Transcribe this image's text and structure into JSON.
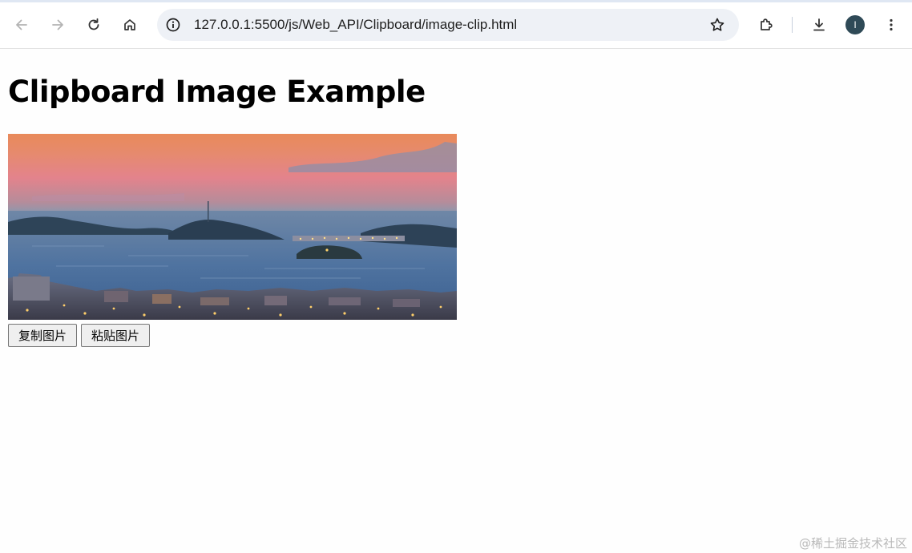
{
  "browser": {
    "url": "127.0.0.1:5500/js/Web_API/Clipboard/image-clip.html",
    "profile_initial": "I",
    "icons": {
      "back": "back-arrow-icon",
      "forward": "forward-arrow-icon",
      "reload": "reload-icon",
      "home": "home-icon",
      "site_info": "info-icon",
      "bookmark": "star-icon",
      "extensions": "puzzle-icon",
      "downloads": "download-icon",
      "menu": "kebab-menu-icon"
    }
  },
  "page": {
    "title": "Clipboard Image Example",
    "copy_button": "复制图片",
    "paste_button": "粘贴图片"
  },
  "watermark": "@稀土掘金技术社区"
}
